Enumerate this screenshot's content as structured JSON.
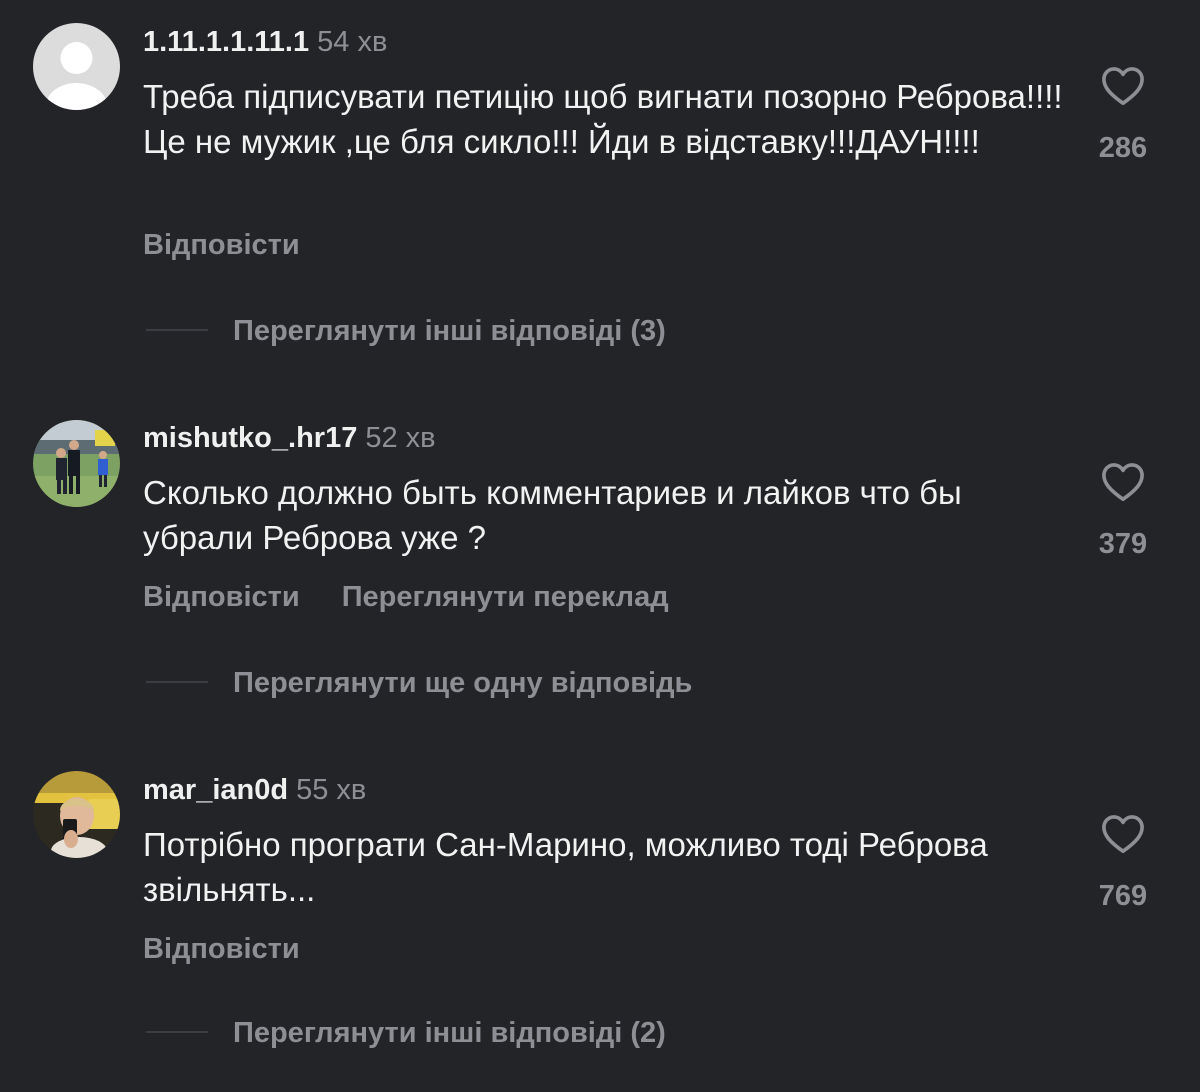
{
  "comments": [
    {
      "username": "1.11.1.1.11.1",
      "time": "54 хв",
      "text": "Треба підписувати петицію щоб вигнати позорно Реброва!!!!Це не мужик ,це бля сикло!!! Йди в відставку!!!ДАУН!!!!",
      "reply_label": "Відповісти",
      "likes": "286",
      "more_replies": "Переглянути інші відповіді (3)"
    },
    {
      "username": "mishutko_.hr17",
      "time": "52 хв",
      "text": "Сколько должно быть комментариев и лайков что бы убрали Реброва уже ?",
      "reply_label": "Відповісти",
      "translate_label": "Переглянути переклад",
      "likes": "379",
      "more_replies": "Переглянути ще одну відповідь"
    },
    {
      "username": "mar_ian0d",
      "time": "55 хв",
      "text": "Потрібно програти Сан-Марино, можливо тоді Реброва звільнять...",
      "reply_label": "Відповісти",
      "likes": "769",
      "more_replies": "Переглянути інші відповіді (2)"
    }
  ],
  "icons": {
    "like": "heart-outline-icon",
    "default_avatar": "person-placeholder-icon"
  },
  "colors": {
    "background": "#222428",
    "primary_text": "#f2f2f2",
    "secondary_text": "#8e8f94"
  }
}
